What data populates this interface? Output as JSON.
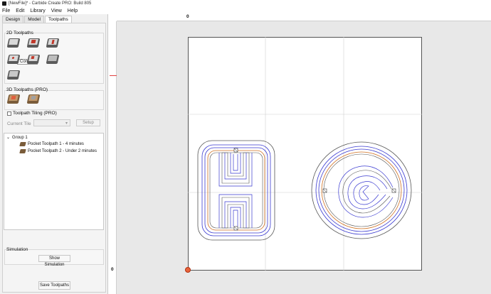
{
  "window": {
    "title": "[NewFile]* - Carbide Create PRO: Build 805"
  },
  "menu": [
    "File",
    "Edit",
    "Library",
    "View",
    "Help"
  ],
  "tabs": [
    "Design",
    "Model",
    "Toolpaths"
  ],
  "active_tab": "Toolpaths",
  "panel": {
    "section_2d": "2D Toolpaths",
    "tooltip": "Contour",
    "section_3d": "3D Toolpaths (PRO)",
    "tiling_label": "Toolpath Tiling (PRO)",
    "current_tile_label": "Current Tile",
    "setup_label": "Setup",
    "tree": {
      "group": "Group 1",
      "items": [
        "Pocket Toolpath 1 - 4 minutes",
        "Pocket Toolpath 2 - Under 2 minutes"
      ]
    },
    "simulation_label": "Simulation",
    "show_simulation": "Show Simulation",
    "save_toolpaths": "Save Toolpaths"
  },
  "rulers": {
    "top_zero": "0",
    "left_zero": "0"
  },
  "colors": {
    "toolpath_blue": "#3a3ad0",
    "toolpath_orange": "#d07020",
    "outline": "#555555",
    "grid": "#d0d0d0"
  }
}
